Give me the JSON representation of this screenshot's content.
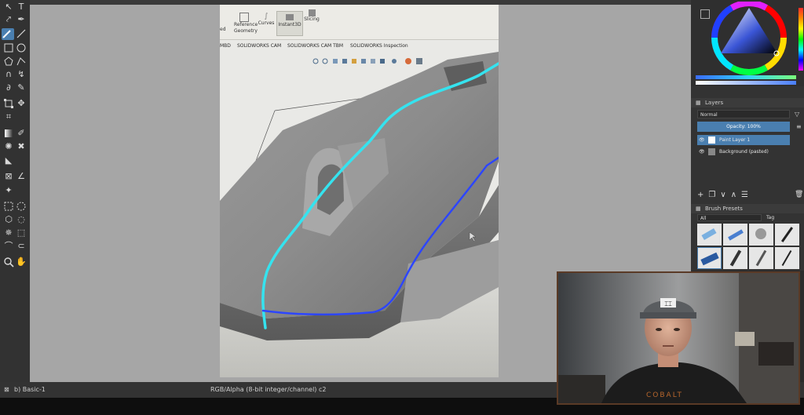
{
  "app": {
    "status_left": "b) Basic-1",
    "status_center": "RGB/Alpha (8-bit integer/channel)  c2"
  },
  "photo": {
    "ribbon_buttons": [
      "Reference Geometry",
      "Curves",
      "Instant3D",
      "Slicing"
    ],
    "ribbon_prefix": "ed",
    "tabs": [
      "MBD",
      "SOLIDWORKS CAM",
      "SOLIDWORKS CAM TBM",
      "SOLIDWORKS Inspection"
    ],
    "stroke_colors": {
      "cyan": "#35e3ef",
      "blue": "#2d46ff"
    }
  },
  "dock": {
    "layers_title": "Layers",
    "blend_mode": "Normal",
    "opacity_label": "Opacity:  100%",
    "layers": [
      {
        "name": "Paint Layer 1",
        "selected": true
      },
      {
        "name": "Background (pasted)",
        "selected": false
      }
    ],
    "brush_presets_title": "Brush Presets",
    "brush_filter": "All",
    "tag_label": "Tag"
  },
  "webcam": {
    "cap_logo": "logo"
  },
  "colors": {
    "accent": "#4a7fb0",
    "canvas_bg": "#a6a6a6",
    "panel_bg": "#333333"
  }
}
